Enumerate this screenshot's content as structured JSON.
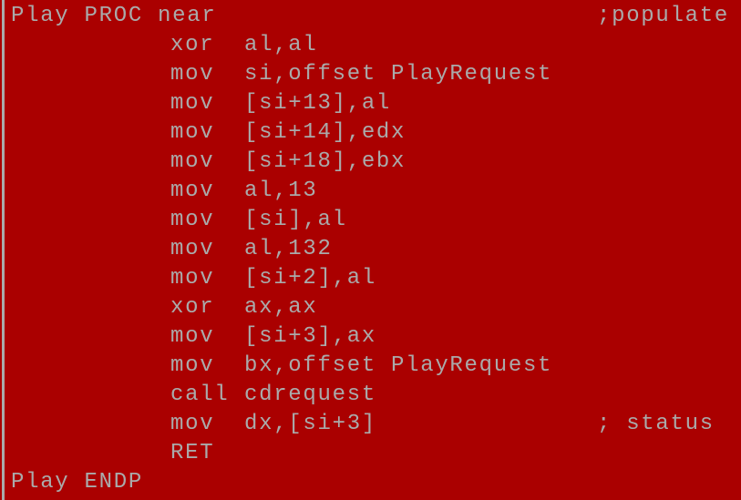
{
  "colors": {
    "background": "#aa0000",
    "text": "#aaaaaa"
  },
  "lines": [
    {
      "label": "Play PROC near",
      "op": "",
      "args": "",
      "comment": ";populate"
    },
    {
      "label": "",
      "op": "xor",
      "args": "al,al",
      "comment": ""
    },
    {
      "label": "",
      "op": "mov",
      "args": "si,offset PlayRequest",
      "comment": ""
    },
    {
      "label": "",
      "op": "mov",
      "args": "[si+13],al",
      "comment": ""
    },
    {
      "label": "",
      "op": "mov",
      "args": "[si+14],edx",
      "comment": ""
    },
    {
      "label": "",
      "op": "mov",
      "args": "[si+18],ebx",
      "comment": ""
    },
    {
      "label": "",
      "op": "mov",
      "args": "al,13",
      "comment": ""
    },
    {
      "label": "",
      "op": "mov",
      "args": "[si],al",
      "comment": ""
    },
    {
      "label": "",
      "op": "mov",
      "args": "al,132",
      "comment": ""
    },
    {
      "label": "",
      "op": "mov",
      "args": "[si+2],al",
      "comment": ""
    },
    {
      "label": "",
      "op": "xor",
      "args": "ax,ax",
      "comment": ""
    },
    {
      "label": "",
      "op": "mov",
      "args": "[si+3],ax",
      "comment": ""
    },
    {
      "label": "",
      "op": "mov",
      "args": "bx,offset PlayRequest",
      "comment": ""
    },
    {
      "label": "",
      "op": "call",
      "args": "cdrequest",
      "comment": ""
    },
    {
      "label": "",
      "op": "mov",
      "args": "dx,[si+3]",
      "comment": "; status"
    },
    {
      "label": "",
      "op": "RET",
      "args": "",
      "comment": ""
    },
    {
      "label": "Play ENDP",
      "op": "",
      "args": "",
      "comment": ""
    }
  ]
}
